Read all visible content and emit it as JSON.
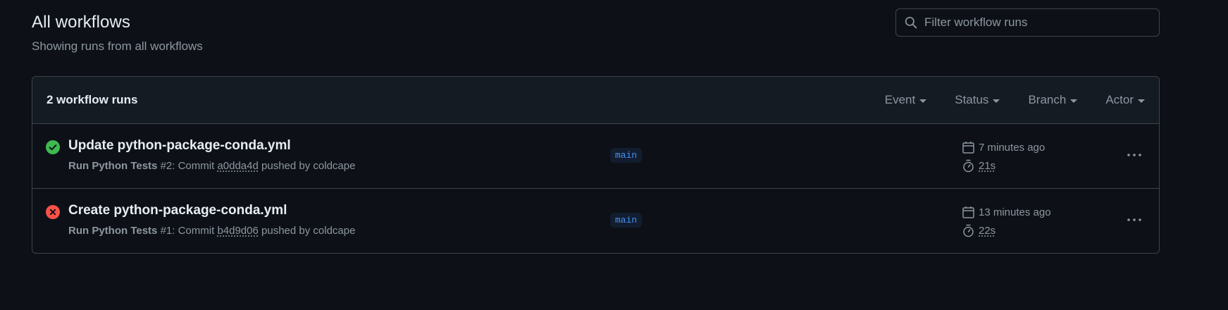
{
  "header": {
    "title": "All workflows",
    "subtitle": "Showing runs from all workflows"
  },
  "search": {
    "placeholder": "Filter workflow runs",
    "value": ""
  },
  "runs_box": {
    "count_label": "2 workflow runs",
    "filters": [
      {
        "label": "Event"
      },
      {
        "label": "Status"
      },
      {
        "label": "Branch"
      },
      {
        "label": "Actor"
      }
    ]
  },
  "runs": [
    {
      "status": "success",
      "status_icon": "check-circle-icon",
      "title": "Update python-package-conda.yml",
      "workflow": "Run Python Tests",
      "meta_middle": " #2: Commit ",
      "commit": "a0dda4d",
      "meta_suffix": " pushed by coldcape",
      "branch": "main",
      "time_ago": "7 minutes ago",
      "duration": "21s"
    },
    {
      "status": "failure",
      "status_icon": "x-circle-icon",
      "title": "Create python-package-conda.yml",
      "workflow": "Run Python Tests",
      "meta_middle": " #1: Commit ",
      "commit": "b4d9d06",
      "meta_suffix": " pushed by coldcape",
      "branch": "main",
      "time_ago": "13 minutes ago",
      "duration": "22s"
    }
  ],
  "colors": {
    "background": "#0d1117",
    "success": "#3fb950",
    "failure": "#f85149",
    "branch_text": "#4493f8",
    "muted_text": "#8d96a0"
  }
}
